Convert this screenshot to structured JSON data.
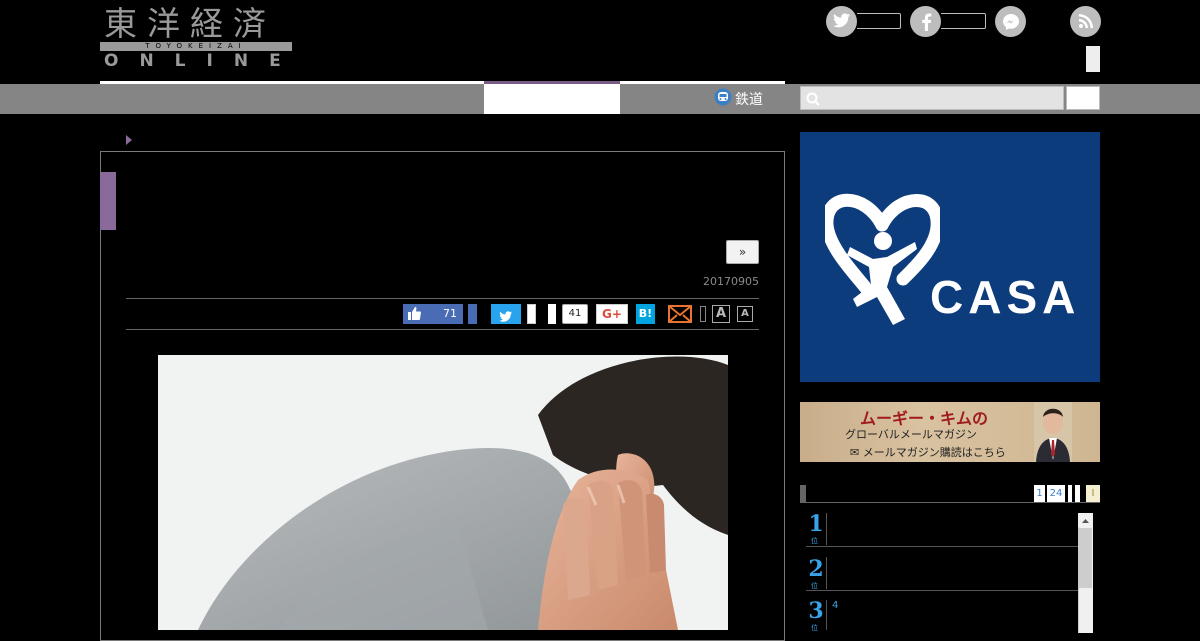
{
  "header": {
    "logo": {
      "kanji": "東洋経済",
      "romaji": "TOYOKEIZAI",
      "online": "ONLINE"
    },
    "icons": [
      "twitter-icon",
      "facebook-icon",
      "messenger-icon",
      "rss-icon"
    ],
    "rail_link": "鉄道"
  },
  "article": {
    "next_label": "»",
    "date": "20170905",
    "share": {
      "facebook_count": "71",
      "pocket_count": "41",
      "google_label": "G+",
      "hatena_label": "B!"
    },
    "font_large": "A",
    "font_small": "A"
  },
  "sidebar": {
    "ad_casa": {
      "text": "CASA"
    },
    "ad_moogi": {
      "title": "ムーギー・キムの",
      "subtitle": "グローバルメールマガジン",
      "cta": "メールマガジン購読はこちら"
    },
    "ranking": {
      "tabs": [
        "1",
        "24"
      ],
      "tab_extra": "I",
      "items": [
        {
          "rank": "1",
          "text": ""
        },
        {
          "rank": "2",
          "text": ""
        },
        {
          "rank": "3",
          "text": "4"
        }
      ],
      "rank_suffix": "位"
    }
  },
  "colors": {
    "accent_purple": "#8a6a9a",
    "nav_gray": "#858585",
    "casa_blue": "#0d3c7c",
    "rank_blue": "#3aa2e8"
  }
}
